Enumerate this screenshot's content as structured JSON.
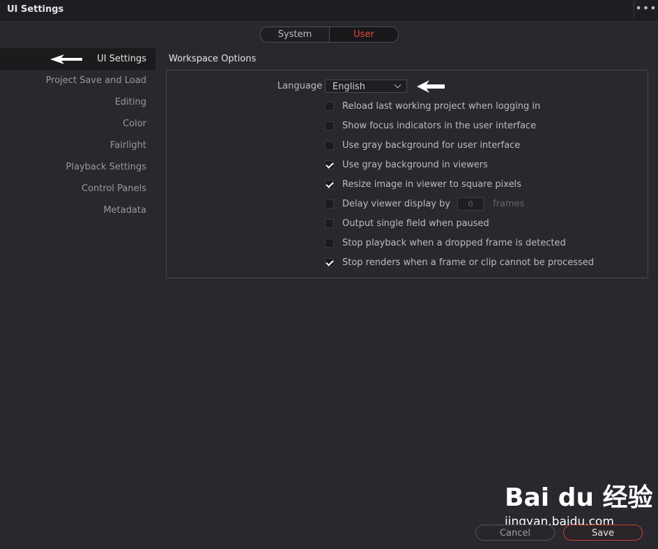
{
  "window": {
    "title": "UI Settings",
    "more_icon": "more-horizontal-icon"
  },
  "scope_tabs": {
    "system": "System",
    "user": "User",
    "active": "User",
    "active_color": "#e24a3b"
  },
  "sidebar": {
    "items": [
      {
        "label": "UI Settings",
        "active": true
      },
      {
        "label": "Project Save and Load"
      },
      {
        "label": "Editing"
      },
      {
        "label": "Color"
      },
      {
        "label": "Fairlight"
      },
      {
        "label": "Playback Settings"
      },
      {
        "label": "Control Panels"
      },
      {
        "label": "Metadata"
      }
    ]
  },
  "workspace": {
    "title": "Workspace Options",
    "language_label": "Language",
    "language_value": "English",
    "options": [
      {
        "label": "Reload last working project when logging in",
        "checked": false
      },
      {
        "label": "Show focus indicators in the user interface",
        "checked": false
      },
      {
        "label": "Use gray background for user interface",
        "checked": false
      },
      {
        "label": "Use gray background in viewers",
        "checked": true
      },
      {
        "label": "Resize image in viewer to square pixels",
        "checked": true
      },
      {
        "label": "Delay viewer display by",
        "checked": false,
        "value": "0",
        "unit": "frames"
      },
      {
        "label": "Output single field when paused",
        "checked": false
      },
      {
        "label": "Stop playback when a dropped frame is detected",
        "checked": false
      },
      {
        "label": "Stop renders when a frame or clip cannot be processed",
        "checked": true
      }
    ]
  },
  "footer": {
    "cancel": "Cancel",
    "save": "Save",
    "save_color": "#c8402f"
  },
  "watermark": {
    "logo": "Bai du 经验",
    "url": "jingyan.baidu.com"
  }
}
